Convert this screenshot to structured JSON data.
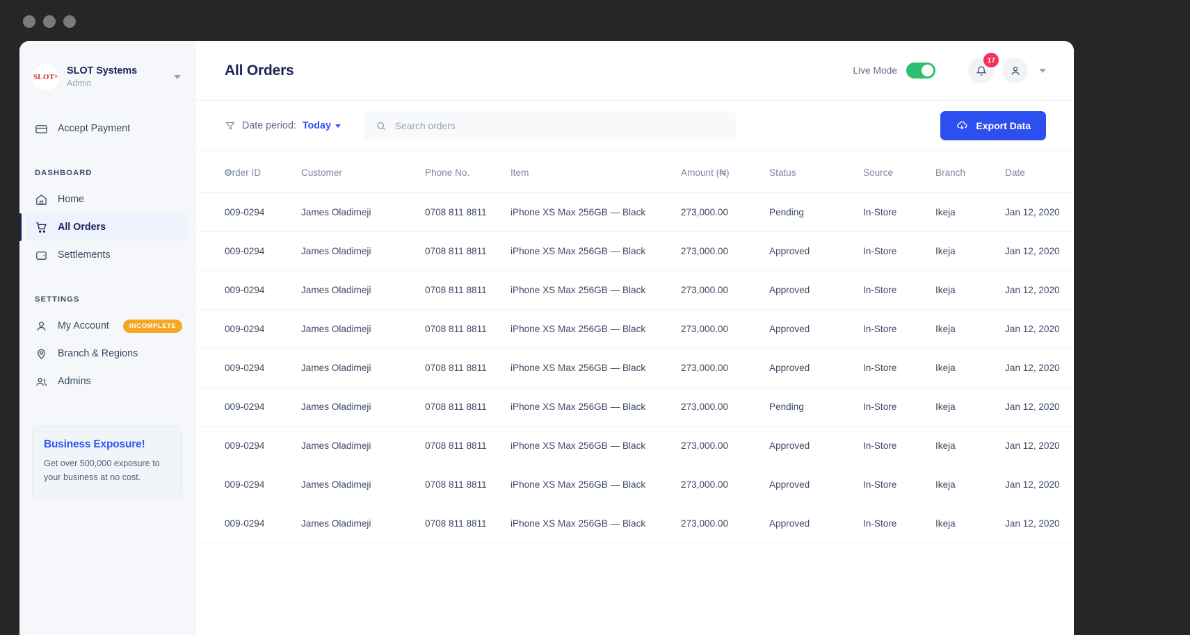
{
  "window": {
    "dots": [
      "close-dot",
      "minimize-dot",
      "maximize-dot"
    ]
  },
  "sidebar": {
    "brand": {
      "logo_text": "SLOT",
      "name": "SLOT Systems",
      "role": "Admin"
    },
    "quick_action": {
      "label": "Accept Payment",
      "icon": "card-icon"
    },
    "sections": [
      {
        "label": "DASHBOARD",
        "items": [
          {
            "label": "Home",
            "icon": "home-icon",
            "active": false
          },
          {
            "label": "All Orders",
            "icon": "cart-icon",
            "active": true
          },
          {
            "label": "Settlements",
            "icon": "wallet-icon",
            "active": false
          }
        ]
      },
      {
        "label": "SETTINGS",
        "items": [
          {
            "label": "My Account",
            "icon": "user-icon",
            "active": false,
            "badge": "INCOMPLETE"
          },
          {
            "label": "Branch & Regions",
            "icon": "pin-icon",
            "active": false
          },
          {
            "label": "Admins",
            "icon": "users-icon",
            "active": false
          }
        ]
      }
    ],
    "promo": {
      "title": "Business Exposure!",
      "body": "Get over 500,000 exposure to your business at no cost."
    }
  },
  "header": {
    "title": "All Orders",
    "live_mode_label": "Live Mode",
    "live_mode_on": true,
    "notification_count": "17"
  },
  "filters": {
    "date_period_label": "Date period:",
    "date_period_value": "Today",
    "search_placeholder": "Search orders",
    "search_value": "",
    "export_label": "Export Data"
  },
  "table": {
    "columns": [
      "",
      "Order ID",
      "Customer",
      "Phone No.",
      "Item",
      "Amount (₦)",
      "Status",
      "Source",
      "Branch",
      "Date"
    ],
    "rows": [
      {
        "order_id": "009-0294",
        "customer": "James Oladimeji",
        "phone": "0708 811 8811",
        "item": "iPhone XS Max 256GB — Black",
        "amount": "273,000.00",
        "status": "Pending",
        "source": "In-Store",
        "branch": "Ikeja",
        "date": "Jan 12, 2020"
      },
      {
        "order_id": "009-0294",
        "customer": "James Oladimeji",
        "phone": "0708 811 8811",
        "item": "iPhone XS Max 256GB — Black",
        "amount": "273,000.00",
        "status": "Approved",
        "source": "In-Store",
        "branch": "Ikeja",
        "date": "Jan 12, 2020"
      },
      {
        "order_id": "009-0294",
        "customer": "James Oladimeji",
        "phone": "0708 811 8811",
        "item": "iPhone XS Max 256GB — Black",
        "amount": "273,000.00",
        "status": "Approved",
        "source": "In-Store",
        "branch": "Ikeja",
        "date": "Jan 12, 2020"
      },
      {
        "order_id": "009-0294",
        "customer": "James Oladimeji",
        "phone": "0708 811 8811",
        "item": "iPhone XS Max 256GB — Black",
        "amount": "273,000.00",
        "status": "Approved",
        "source": "In-Store",
        "branch": "Ikeja",
        "date": "Jan 12, 2020"
      },
      {
        "order_id": "009-0294",
        "customer": "James Oladimeji",
        "phone": "0708 811 8811",
        "item": "iPhone XS Max 256GB — Black",
        "amount": "273,000.00",
        "status": "Approved",
        "source": "In-Store",
        "branch": "Ikeja",
        "date": "Jan 12, 2020"
      },
      {
        "order_id": "009-0294",
        "customer": "James Oladimeji",
        "phone": "0708 811 8811",
        "item": "iPhone XS Max 256GB — Black",
        "amount": "273,000.00",
        "status": "Pending",
        "source": "In-Store",
        "branch": "Ikeja",
        "date": "Jan 12, 2020"
      },
      {
        "order_id": "009-0294",
        "customer": "James Oladimeji",
        "phone": "0708 811 8811",
        "item": "iPhone XS Max 256GB — Black",
        "amount": "273,000.00",
        "status": "Approved",
        "source": "In-Store",
        "branch": "Ikeja",
        "date": "Jan 12, 2020"
      },
      {
        "order_id": "009-0294",
        "customer": "James Oladimeji",
        "phone": "0708 811 8811",
        "item": "iPhone XS Max 256GB — Black",
        "amount": "273,000.00",
        "status": "Approved",
        "source": "In-Store",
        "branch": "Ikeja",
        "date": "Jan 12, 2020"
      },
      {
        "order_id": "009-0294",
        "customer": "James Oladimeji",
        "phone": "0708 811 8811",
        "item": "iPhone XS Max 256GB — Black",
        "amount": "273,000.00",
        "status": "Approved",
        "source": "In-Store",
        "branch": "Ikeja",
        "date": "Jan 12, 2020"
      }
    ]
  },
  "colors": {
    "accent_blue": "#2d4ff0",
    "link_blue": "#3355f2",
    "status_pending": "#f5a623",
    "status_approved": "#2a3654",
    "toggle_green": "#2fbf71",
    "dot_green": "#2fbf71",
    "badge_pink": "#f5315e",
    "badge_orange": "#f5a623",
    "navy": "#1b2559"
  }
}
